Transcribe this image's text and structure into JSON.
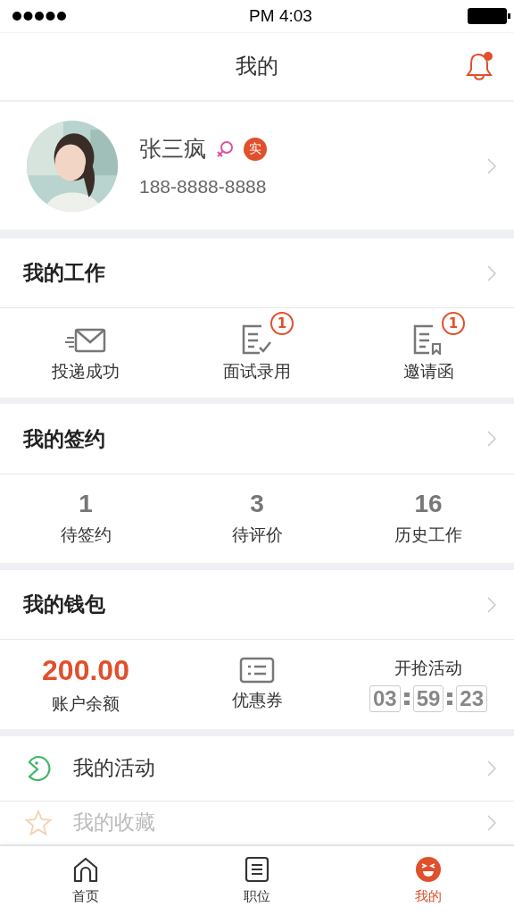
{
  "status_bar": {
    "time": "PM 4:03"
  },
  "header": {
    "title": "我的",
    "unread": true
  },
  "profile": {
    "name": "张三疯",
    "verified_badge": "实",
    "phone": "188-8888-8888"
  },
  "work": {
    "title": "我的工作",
    "items": [
      {
        "kind": "envelope",
        "label": "投递成功"
      },
      {
        "kind": "check-doc",
        "label": "面试录用",
        "badge": "1"
      },
      {
        "kind": "ribbon-doc",
        "label": "邀请函",
        "badge": "1"
      }
    ]
  },
  "contracts": {
    "title": "我的签约",
    "stats": [
      {
        "value": "1",
        "label": "待签约"
      },
      {
        "value": "3",
        "label": "待评价"
      },
      {
        "value": "16",
        "label": "历史工作"
      }
    ]
  },
  "wallet": {
    "title": "我的钱包",
    "balance": {
      "value": "200.00",
      "label": "账户余额"
    },
    "coupon": {
      "label": "优惠券"
    },
    "countdown": {
      "title": "开抢活动",
      "digits": [
        "03",
        "59",
        "23"
      ]
    }
  },
  "list": [
    {
      "kind": "activity",
      "label": "我的活动"
    },
    {
      "kind": "favorite",
      "label": "我的收藏"
    }
  ],
  "tabs": [
    {
      "kind": "home",
      "label": "首页",
      "selected": false
    },
    {
      "kind": "jobs",
      "label": "职位",
      "selected": false
    },
    {
      "kind": "me",
      "label": "我的",
      "selected": true
    }
  ]
}
